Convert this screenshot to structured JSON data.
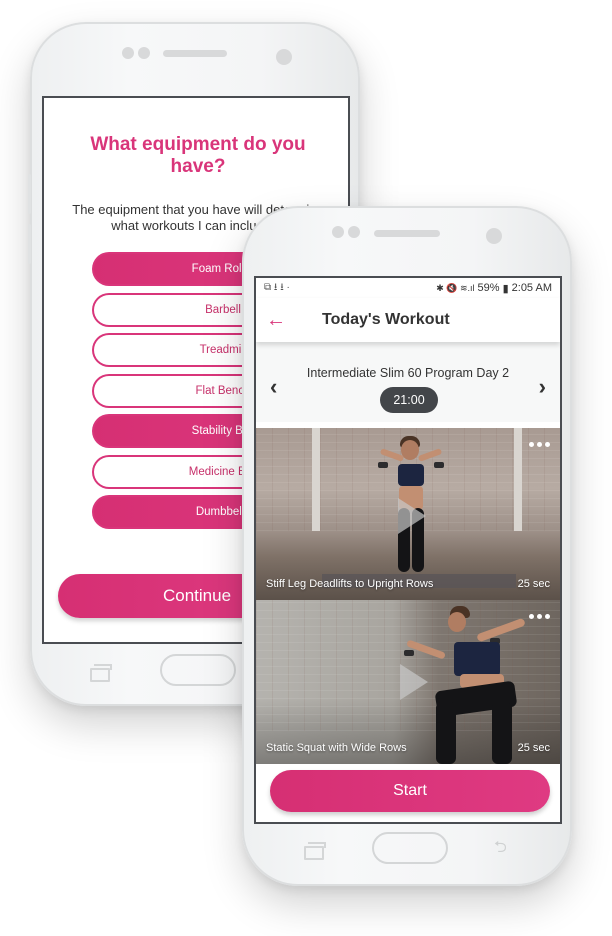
{
  "equipment_screen": {
    "title": "What equipment do you have?",
    "description": "The equipment that you have will determine what workouts I can include in",
    "items": [
      {
        "label": "Foam Roller",
        "selected": true
      },
      {
        "label": "Barbell",
        "selected": false
      },
      {
        "label": "Treadmill",
        "selected": false
      },
      {
        "label": "Flat Bench",
        "selected": false
      },
      {
        "label": "Stability Ball",
        "selected": true
      },
      {
        "label": "Medicine Ball",
        "selected": false
      },
      {
        "label": "Dumbbells",
        "selected": true
      }
    ],
    "continue_label": "Continue"
  },
  "workout_screen": {
    "status_bar": {
      "left_icons": [
        "screenshot-icon",
        "download-icon",
        "download-icon",
        "dot-icon"
      ],
      "left_glyphs": "⧉ ⭳ ⭳ ·",
      "right_glyphs": "✱ 🔇 ≋.ıl",
      "battery": "59%",
      "battery_glyph": "▮",
      "time": "2:05 AM"
    },
    "app_bar": {
      "back_glyph": "←",
      "title": "Today's Workout"
    },
    "program": {
      "title": "Intermediate Slim 60 Program Day 2",
      "duration": "21:00",
      "prev_glyph": "‹",
      "next_glyph": "›"
    },
    "exercises": [
      {
        "name": "Stiff Leg Deadlifts to Upright Rows",
        "duration": "25 sec"
      },
      {
        "name": "Static Squat with Wide Rows",
        "duration": "25 sec"
      }
    ],
    "start_label": "Start",
    "nav_back_glyph": "⮌"
  },
  "colors": {
    "accent": "#d9357a",
    "pill_dark": "#43464a",
    "text": "#333333"
  }
}
